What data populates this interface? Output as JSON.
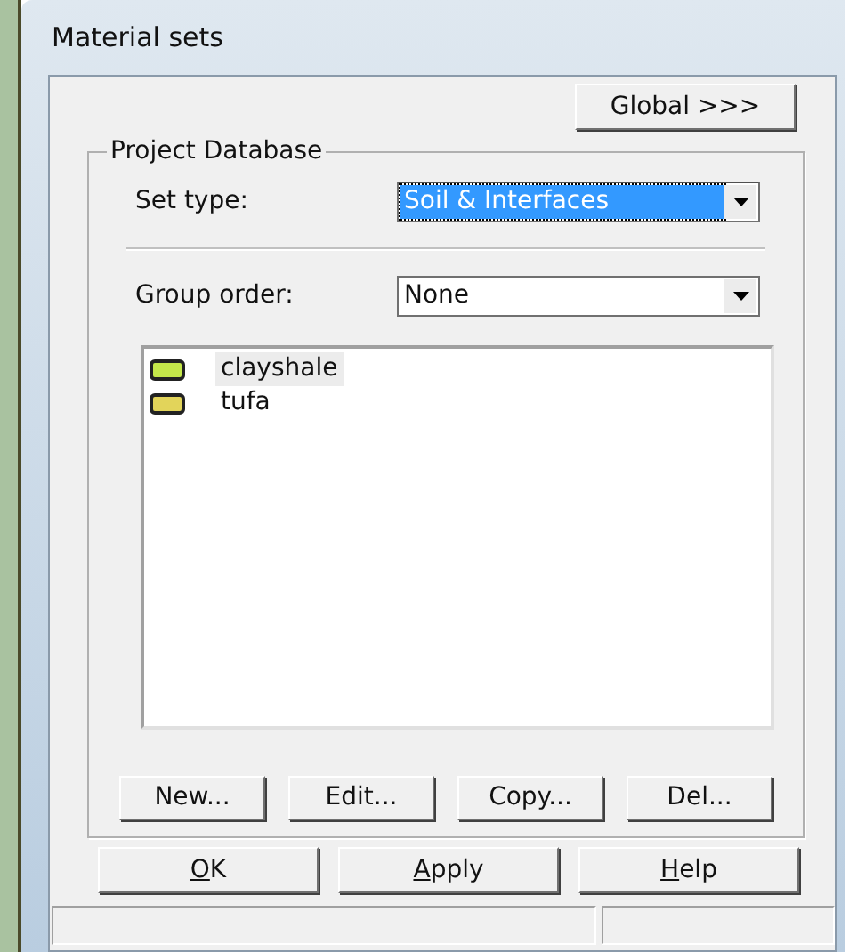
{
  "window": {
    "title": "Material sets"
  },
  "global_button": "Global >>>",
  "group": {
    "title": "Project Database",
    "set_type": {
      "label": "Set type:",
      "value": "Soil & Interfaces",
      "focused": true
    },
    "group_order": {
      "label": "Group order:",
      "value": "None"
    },
    "materials": [
      {
        "name": "clayshale",
        "color": "#c5e84a",
        "selected": true
      },
      {
        "name": "tufa",
        "color": "#e2d45a",
        "selected": false
      }
    ],
    "buttons": [
      "New...",
      "Edit...",
      "Copy...",
      "Del..."
    ]
  },
  "dialog_buttons": [
    {
      "label": "OK",
      "underline_first": true
    },
    {
      "label": "Apply",
      "underline_first": true
    },
    {
      "label": "Help",
      "underline_first": true
    }
  ]
}
